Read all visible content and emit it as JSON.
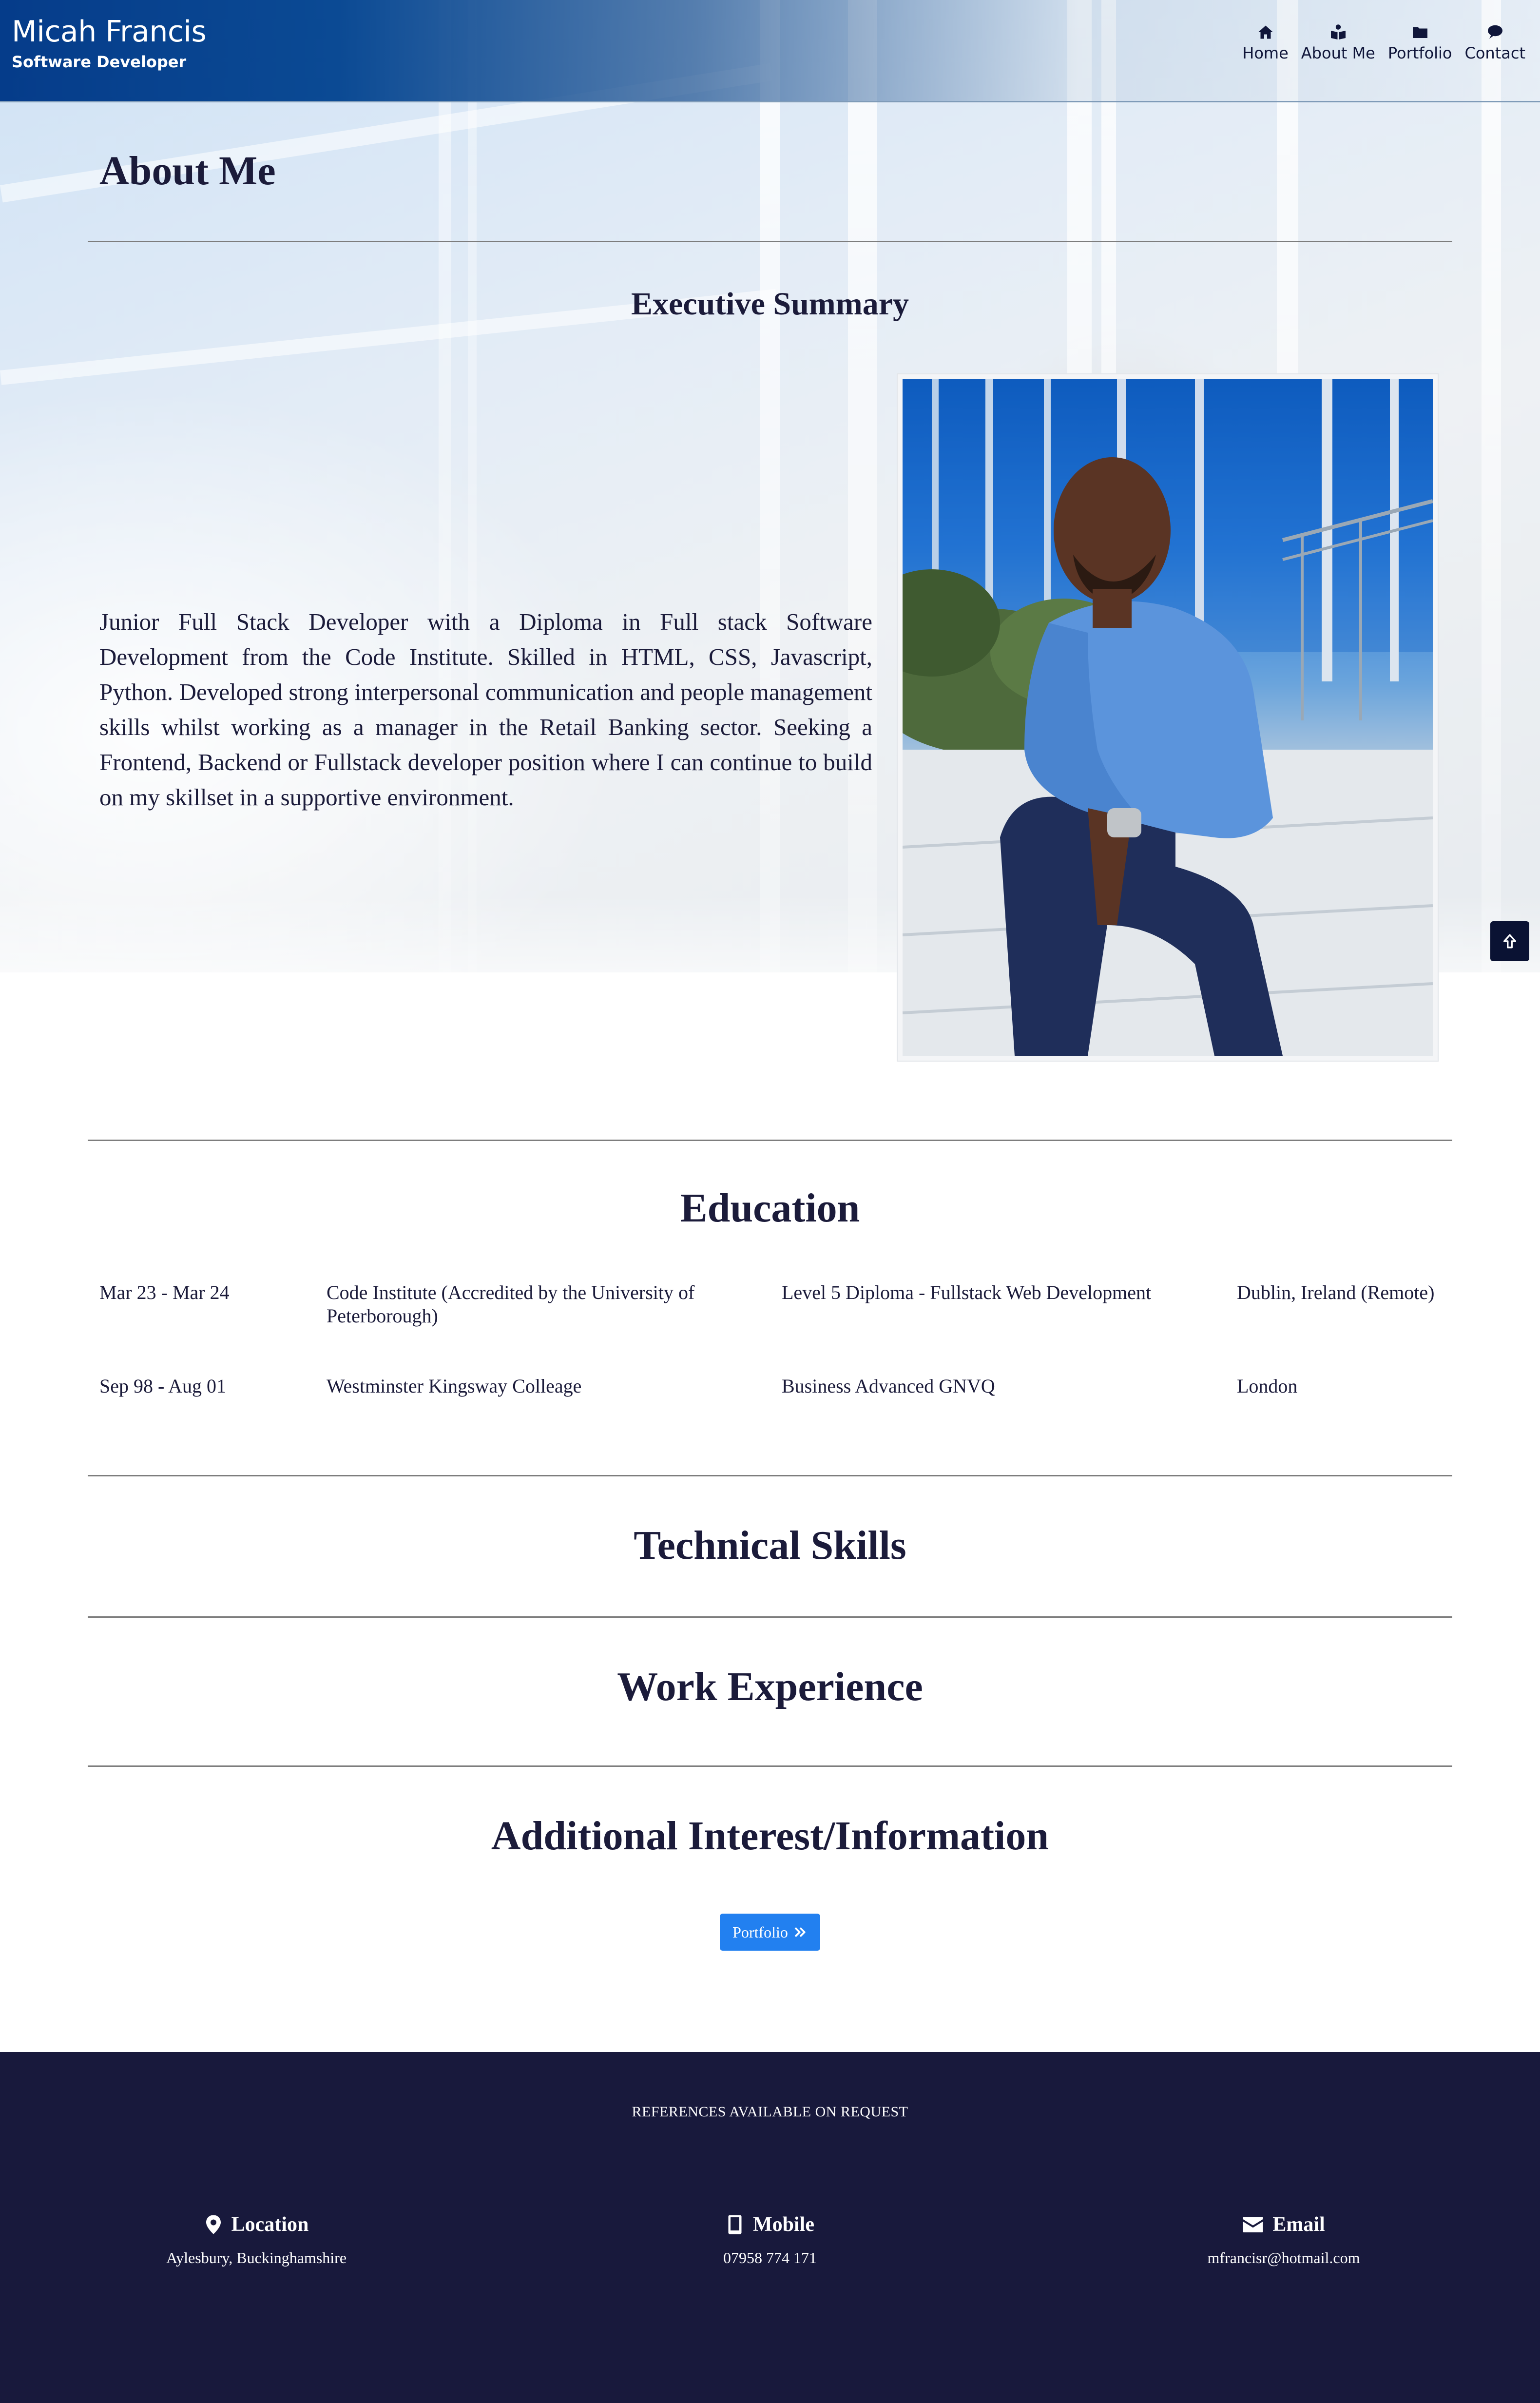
{
  "header": {
    "name": "Micah Francis",
    "subtitle": "Software Developer",
    "nav": [
      {
        "label": "Home",
        "icon": "home-icon"
      },
      {
        "label": "About Me",
        "icon": "person-reading-icon"
      },
      {
        "label": "Portfolio",
        "icon": "folder-icon"
      },
      {
        "label": "Contact",
        "icon": "chat-bubble-icon"
      }
    ]
  },
  "about": {
    "title": "About Me",
    "summary_title": "Executive Summary",
    "summary": "Junior Full Stack Developer with a Diploma in Full stack Software Development from the Code Institute. Skilled in HTML, CSS, Javascript, Python. Developed strong interpersonal communication and people management skills whilst working as a manager in the Retail Banking sector. Seeking a Frontend, Backend or Fullstack developer position where I can continue to build on my skillset in a supportive environment."
  },
  "education": {
    "title": "Education",
    "rows": [
      {
        "dates": "Mar 23 - Mar 24",
        "institution": "Code Institute (Accredited by the University of Peterborough)",
        "qualification": "Level 5 Diploma - Fullstack Web Development",
        "location": "Dublin, Ireland (Remote)"
      },
      {
        "dates": "Sep 98 - Aug 01",
        "institution": "Westminster Kingsway Colleage",
        "qualification": "Business Advanced GNVQ",
        "location": "London"
      }
    ]
  },
  "sections": {
    "skills_title": "Technical Skills",
    "work_title": "Work Experience",
    "additional_title": "Additional Interest/Information"
  },
  "portfolio_button": {
    "label": "Portfolio",
    "icon": "double-chevron-right-icon"
  },
  "footer": {
    "references": "REFERENCES AVAILABLE ON REQUEST",
    "contacts": [
      {
        "heading": "Location",
        "value": "Aylesbury, Buckinghamshire",
        "icon": "map-pin-icon"
      },
      {
        "heading": "Mobile",
        "value": "07958 774 171",
        "icon": "mobile-phone-icon"
      },
      {
        "heading": "Email",
        "value": "mfrancisr@hotmail.com",
        "icon": "envelope-icon"
      }
    ]
  },
  "colors": {
    "header_blue": "#053c8a",
    "text_dark": "#1b1b3a",
    "button_blue": "#2280f0",
    "footer_navy": "#18193c",
    "back_to_top": "#0a1233"
  }
}
